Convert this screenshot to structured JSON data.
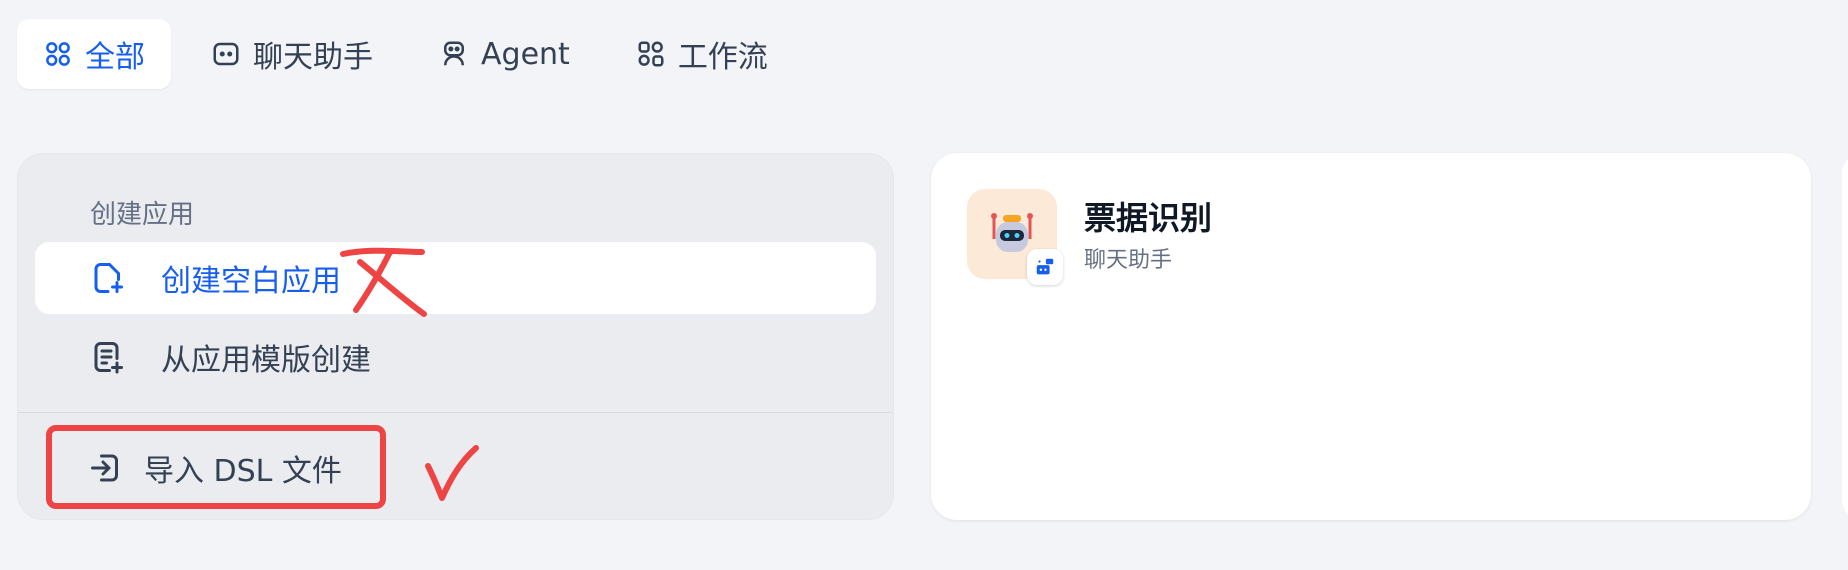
{
  "tabs": [
    {
      "label": "全部",
      "icon": "grid-icon",
      "active": true
    },
    {
      "label": "聊天助手",
      "icon": "chat-icon",
      "active": false
    },
    {
      "label": "Agent",
      "icon": "robot-icon",
      "active": false
    },
    {
      "label": "工作流",
      "icon": "workflow-icon",
      "active": false
    }
  ],
  "create_panel": {
    "section_title": "创建应用",
    "items": [
      {
        "label": "创建空白应用",
        "icon": "new-file-icon"
      },
      {
        "label": "从应用模版创建",
        "icon": "template-icon"
      }
    ],
    "import_label": "导入 DSL 文件",
    "import_icon": "import-icon"
  },
  "app_card": {
    "title": "票据识别",
    "type": "聊天助手",
    "icon": "robot-avatar-icon",
    "badge_icon": "chat-badge-icon",
    "icon_bg": "#fde9d7"
  },
  "colors": {
    "accent": "#155eef",
    "annotation": "#ef4444"
  }
}
